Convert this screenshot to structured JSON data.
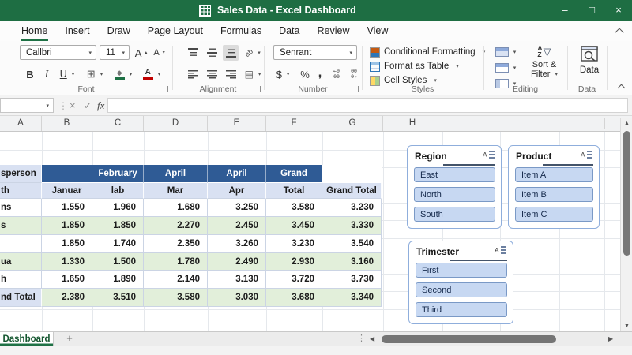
{
  "colors": {
    "titlebar_green": "#1E6E43",
    "accent_green": "#1E7145",
    "table_header_blue": "#2F5B95",
    "table_header_light_blue": "#D9E1F2",
    "row_alt_green": "#E2EFDA",
    "slicer_item_fill": "#C7D8F2",
    "fill_color_bar": "#1E7145",
    "font_color_bar": "#C00000"
  },
  "icons": {
    "minimize": "–",
    "maximize": "□",
    "close": "×",
    "dropdown": "▾",
    "cancel": "×",
    "confirm": "✓",
    "splitter": "⋮",
    "borders": "⊞",
    "merge": "▤",
    "fill_shape": "◆",
    "funnel": "▽",
    "scroll_up": "▲",
    "scroll_down": "▼",
    "scroll_left": "◀",
    "scroll_right": "▶",
    "grow_tick": "▲",
    "shrink_tick": "▼"
  },
  "window": {
    "title": "Sales Data - Excel Dashboard"
  },
  "menu": {
    "tabs": [
      "Home",
      "Insert",
      "Draw",
      "Page Layout",
      "Formulas",
      "Data",
      "Review",
      "View"
    ],
    "active": "Home"
  },
  "ribbon": {
    "font": {
      "group_label": "Font",
      "font_name": "Callbri",
      "font_size": "11",
      "bold": "B",
      "italic": "I",
      "underline": "U",
      "grow_font": "A",
      "shrink_font": "A",
      "font_color_letter": "A"
    },
    "alignment": {
      "group_label": "Alignment",
      "orientation_label": "ab"
    },
    "number": {
      "group_label": "Number",
      "format": "Senrant",
      "currency": "$",
      "percent": "%",
      "comma": ",",
      "inc_decimal_top": "←0",
      "inc_decimal_bottom": "00",
      "dec_decimal_top": "00",
      "dec_decimal_bottom": "0→"
    },
    "styles": {
      "group_label": "Styles",
      "conditional_formatting": "Conditional Formatting",
      "format_as_table": "Format as Table",
      "cell_styles": "Cell Styles"
    },
    "editing": {
      "group_label": "Editing",
      "sort_filter_line1": "Sort &",
      "sort_filter_line2": "Filter",
      "az_a": "A",
      "az_z": "Z"
    },
    "data": {
      "group_label": "Data",
      "button_label": "Data"
    }
  },
  "formula_bar": {
    "fx_label": "fx",
    "name_box_value": "",
    "value": ""
  },
  "sheet": {
    "column_headers": [
      "A",
      "B",
      "C",
      "D",
      "E",
      "F",
      "G",
      "H"
    ],
    "table": {
      "header_row1": [
        "sperson",
        "",
        "February",
        "April",
        "April",
        "Grand",
        ""
      ],
      "header_row2": [
        "th",
        "Januar",
        "lab",
        "Mar",
        "Apr",
        "Total",
        "Grand Total"
      ],
      "rows": [
        {
          "label": "ns",
          "values": [
            "1.550",
            "1.960",
            "1.680",
            "3.250",
            "3.580",
            "3.230"
          ]
        },
        {
          "label": "s",
          "values": [
            "1.850",
            "1.850",
            "2.270",
            "2.450",
            "3.450",
            "3.330"
          ]
        },
        {
          "label": "",
          "values": [
            "1.850",
            "1.740",
            "2.350",
            "3.260",
            "3.230",
            "3.540"
          ]
        },
        {
          "label": "ua",
          "values": [
            "1.330",
            "1.500",
            "1.780",
            "2.490",
            "2.930",
            "3.160"
          ]
        },
        {
          "label": "h",
          "values": [
            "1.650",
            "1.890",
            "2.140",
            "3.130",
            "3.720",
            "3.730"
          ]
        }
      ],
      "total_row": {
        "label": "nd Total",
        "values": [
          "2.380",
          "3.510",
          "3.580",
          "3.030",
          "3.680",
          "3.340"
        ]
      }
    },
    "slicers": [
      {
        "title": "Region",
        "items": [
          "East",
          "North",
          "South"
        ]
      },
      {
        "title": "Product",
        "items": [
          "Item A",
          "Item B",
          "Item C"
        ]
      },
      {
        "title": "Trimester",
        "items": [
          "First",
          "Second",
          "Third"
        ]
      }
    ]
  },
  "sheet_tabs": {
    "active": "Dashboard",
    "new_sheet": "+"
  }
}
